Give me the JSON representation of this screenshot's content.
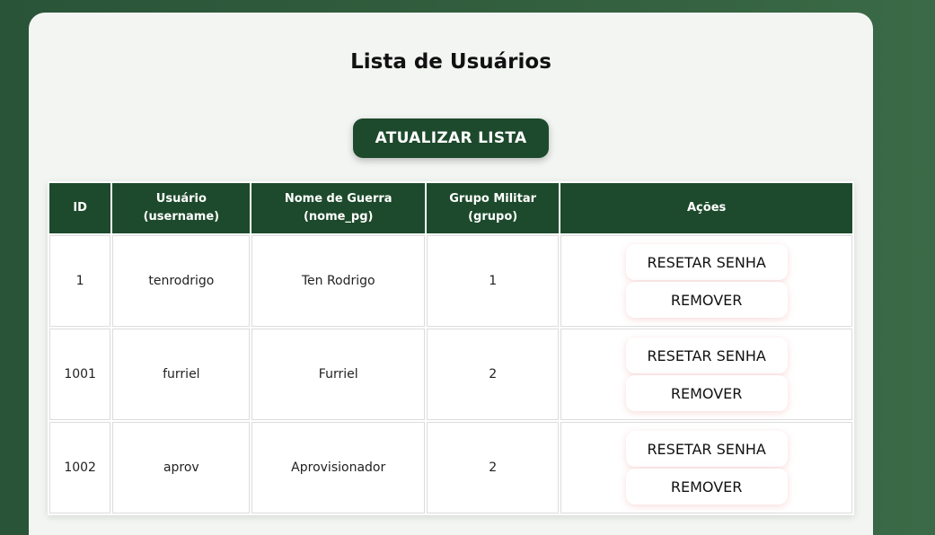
{
  "page": {
    "title": "Lista de Usuários",
    "refresh_label": "ATUALIZAR LISTA"
  },
  "table": {
    "headers": {
      "id": "ID",
      "user_line1": "Usuário",
      "user_line2": "(username)",
      "name_line1": "Nome de Guerra",
      "name_line2": "(nome_pg)",
      "group_line1": "Grupo Militar",
      "group_line2": "(grupo)",
      "actions": "Ações"
    },
    "rows": [
      {
        "id": "1",
        "username": "tenrodrigo",
        "nome_pg": "Ten Rodrigo",
        "grupo": "1"
      },
      {
        "id": "1001",
        "username": "furriel",
        "nome_pg": "Furriel",
        "grupo": "2"
      },
      {
        "id": "1002",
        "username": "aprov",
        "nome_pg": "Aprovisionador",
        "grupo": "2"
      }
    ],
    "actions": {
      "reset_label": "RESETAR SENHA",
      "remove_label": "REMOVER"
    }
  },
  "colors": {
    "primary": "#1d4a2c",
    "background": "#2f5a3c",
    "card": "#f3f5f3"
  }
}
